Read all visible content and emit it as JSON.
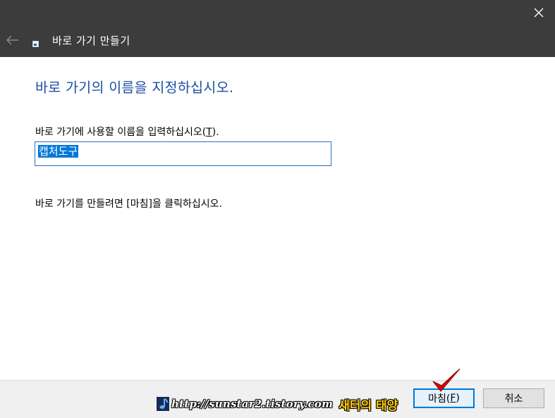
{
  "window": {
    "title": "바로 가기 만들기",
    "close_icon": "close-icon",
    "back_icon": "back-arrow-icon"
  },
  "content": {
    "heading": "바로 가기의 이름을 지정하십시오.",
    "prompt_before": "바로 가기에 사용할 이름을 입력하십시오(",
    "prompt_access_key": "T",
    "prompt_after": ").",
    "name_value": "캡처도구",
    "instruction": "바로 가기를 만들려면 [마침]을 클릭하십시오."
  },
  "footer": {
    "finish_before": "마침(",
    "finish_key": "F",
    "finish_after": ")",
    "cancel_label": "취소"
  },
  "watermark": {
    "url": "http://sunstar2.tistory.com",
    "name": "새터의 태양"
  },
  "colors": {
    "titlebar": "#3c3c3c",
    "heading": "#1a4fa3",
    "selection": "#0078d7",
    "footer": "#f0f0f0",
    "checkmark": "#e00000"
  }
}
